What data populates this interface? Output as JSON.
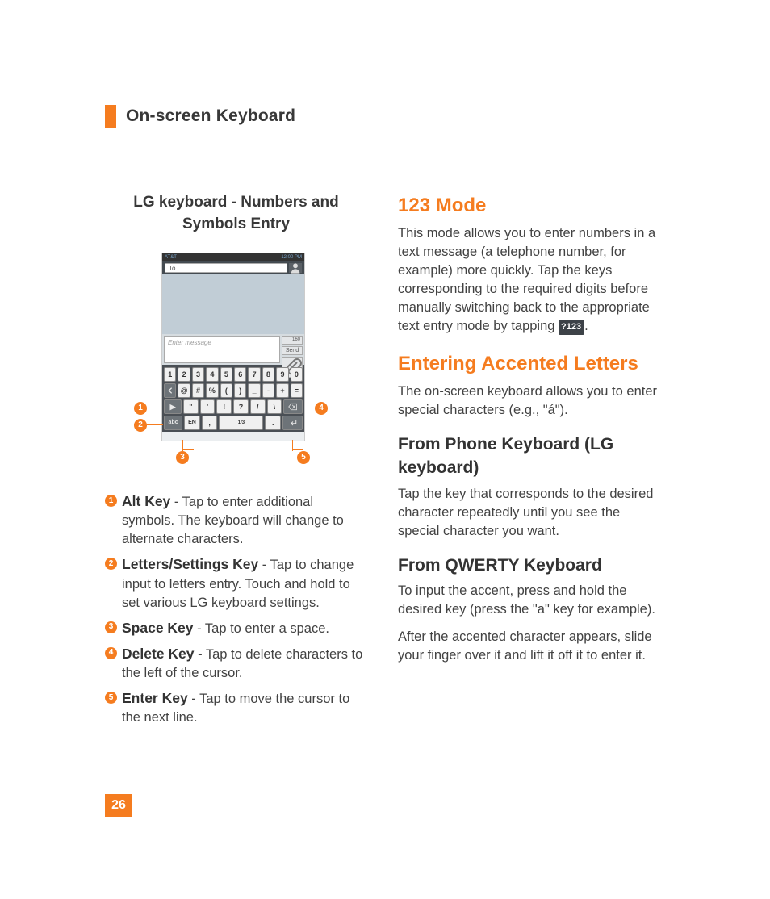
{
  "section_title": "On-screen Keyboard",
  "page_number": "26",
  "left": {
    "figure_title": "LG keyboard - Numbers and Symbols Entry",
    "phone": {
      "carrier": "AT&T",
      "time": "12:00 PM",
      "to_label": "To",
      "compose_placeholder": "Enter message",
      "char_count": "160",
      "send": "Send",
      "row1": [
        "1",
        "2",
        "3",
        "4",
        "5",
        "6",
        "7",
        "8",
        "9",
        "0"
      ],
      "row2": [
        "@",
        "#",
        "%",
        "(",
        ")",
        "_",
        "-",
        "+",
        "="
      ],
      "row3_left": "▶",
      "row3": [
        "\"",
        "'",
        "!",
        "?",
        "/",
        "\\"
      ],
      "row4_abc": "abc",
      "row4_en": "EN",
      "row4_comma": ",",
      "row4_space": "1/3",
      "row4_dot": "."
    },
    "legend": [
      {
        "num": "1",
        "title": "Alt Key",
        "desc": " - Tap to enter additional symbols. The keyboard will change to alternate characters."
      },
      {
        "num": "2",
        "title": "Letters/Settings Key",
        "desc": " - Tap to change input to letters entry. Touch and hold to set various LG keyboard settings."
      },
      {
        "num": "3",
        "title": "Space Key",
        "desc": " - Tap to enter a space."
      },
      {
        "num": "4",
        "title": "Delete Key",
        "desc": " - Tap to delete characters to the left of the cursor."
      },
      {
        "num": "5",
        "title": "Enter Key",
        "desc": " - Tap to move the cursor to the next line."
      }
    ]
  },
  "right": {
    "h1": "123 Mode",
    "p1a": "This mode allows you to enter numbers in a text message (a telephone number, for example) more quickly. Tap the keys corresponding to the required digits before manually switching back to the appropriate text entry mode by tapping ",
    "mode_key": "?123",
    "p1b": ".",
    "h2": "Entering Accented Letters",
    "p2": "The on-screen keyboard allows you to enter special characters (e.g., \"á\").",
    "h3": "From Phone Keyboard (LG keyboard)",
    "p3": "Tap the key that corresponds to the desired character repeatedly until you see the special character you want.",
    "h4": "From QWERTY Keyboard",
    "p4": "To input the accent, press and hold the desired key (press the \"a\" key for example).",
    "p5": "After the accented character appears, slide your finger over it and lift it off it to enter it."
  }
}
